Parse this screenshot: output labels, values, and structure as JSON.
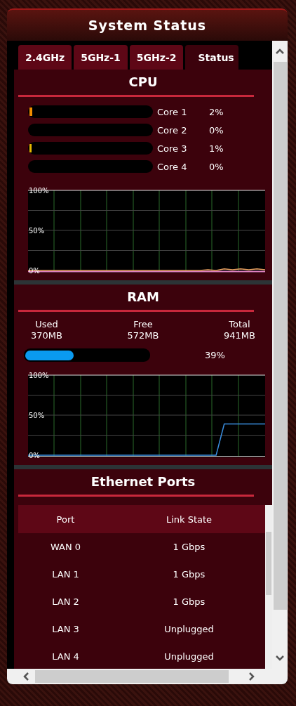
{
  "title": "System Status",
  "tabs": [
    {
      "label": "2.4GHz",
      "selected": false
    },
    {
      "label": "5GHz-1",
      "selected": false
    },
    {
      "label": "5GHz-2",
      "selected": false
    },
    {
      "label": "Status",
      "selected": true
    }
  ],
  "cpu": {
    "title": "CPU",
    "cores": [
      {
        "name": "Core 1",
        "usage": "2%",
        "level": 0.02,
        "color": "#f08c00"
      },
      {
        "name": "Core 2",
        "usage": "0%"
      },
      {
        "name": "Core 3",
        "usage": "1%",
        "level": 0.01,
        "color": "#e8b800"
      },
      {
        "name": "Core 4",
        "usage": "0%"
      }
    ],
    "chart_data": {
      "type": "line",
      "ylim": [
        0,
        100
      ],
      "yticks": [
        {
          "value": 0,
          "label": "0%"
        },
        {
          "value": 50,
          "label": "50%"
        },
        {
          "value": 100,
          "label": "100%"
        }
      ],
      "series": [
        {
          "color": "#e8a060",
          "values": [
            0,
            0,
            0,
            0,
            0,
            0,
            0,
            0,
            0,
            0,
            0,
            0,
            0,
            0,
            0,
            0,
            0,
            0,
            0,
            0,
            0,
            0,
            1,
            0,
            2,
            1,
            2,
            1,
            2,
            1
          ]
        }
      ]
    }
  },
  "ram": {
    "title": "RAM",
    "stats": [
      {
        "label": "Used",
        "value": "370MB"
      },
      {
        "label": "Free",
        "value": "572MB"
      },
      {
        "label": "Total",
        "value": "941MB"
      }
    ],
    "level": 0.39,
    "percent": "39%",
    "chart_data": {
      "type": "line",
      "ylim": [
        0,
        100
      ],
      "yticks": [
        {
          "value": 0,
          "label": "0%"
        },
        {
          "value": 50,
          "label": "50%"
        },
        {
          "value": 100,
          "label": "100%"
        }
      ],
      "series": [
        {
          "color": "#3a8ee0",
          "values": [
            0,
            0,
            0,
            0,
            0,
            0,
            0,
            0,
            0,
            0,
            0,
            0,
            0,
            0,
            0,
            0,
            0,
            0,
            0,
            0,
            0,
            0,
            0,
            0,
            39,
            39,
            39,
            39,
            39,
            39
          ]
        }
      ]
    }
  },
  "ethernet": {
    "title": "Ethernet Ports",
    "columns": [
      "Port",
      "Link State"
    ],
    "rows": [
      [
        "WAN 0",
        "1 Gbps"
      ],
      [
        "LAN 1",
        "1 Gbps"
      ],
      [
        "LAN 2",
        "1 Gbps"
      ],
      [
        "LAN 3",
        "Unplugged"
      ],
      [
        "LAN 4",
        "Unplugged"
      ]
    ]
  }
}
